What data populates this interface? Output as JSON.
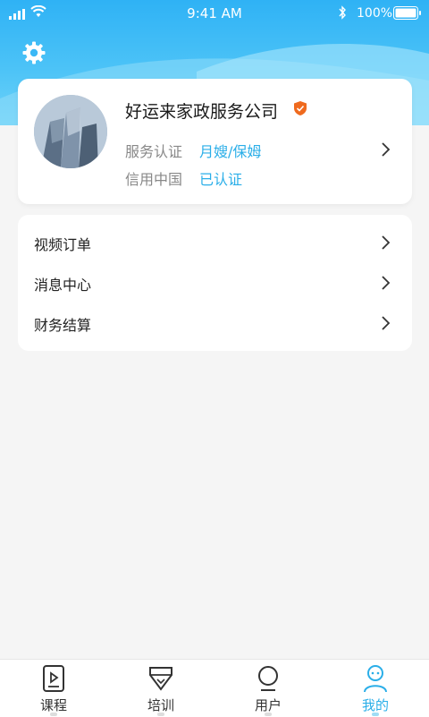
{
  "status_bar": {
    "time": "9:41 AM",
    "battery": "100%"
  },
  "profile": {
    "company_name": "好运来家政服务公司",
    "service_label": "服务认证",
    "service_value": "月嫂/保姆",
    "credit_label": "信用中国",
    "credit_value": "已认证"
  },
  "menu": {
    "items": [
      {
        "label": "视频订单"
      },
      {
        "label": "消息中心"
      },
      {
        "label": "财务结算"
      }
    ]
  },
  "tabbar": {
    "items": [
      {
        "label": "课程",
        "icon": "course-icon"
      },
      {
        "label": "培训",
        "icon": "training-icon"
      },
      {
        "label": "用户",
        "icon": "user-icon"
      },
      {
        "label": "我的",
        "icon": "profile-icon"
      }
    ],
    "active_index": 3
  },
  "colors": {
    "accent": "#2aaee8",
    "header": "#3bb8f6"
  }
}
